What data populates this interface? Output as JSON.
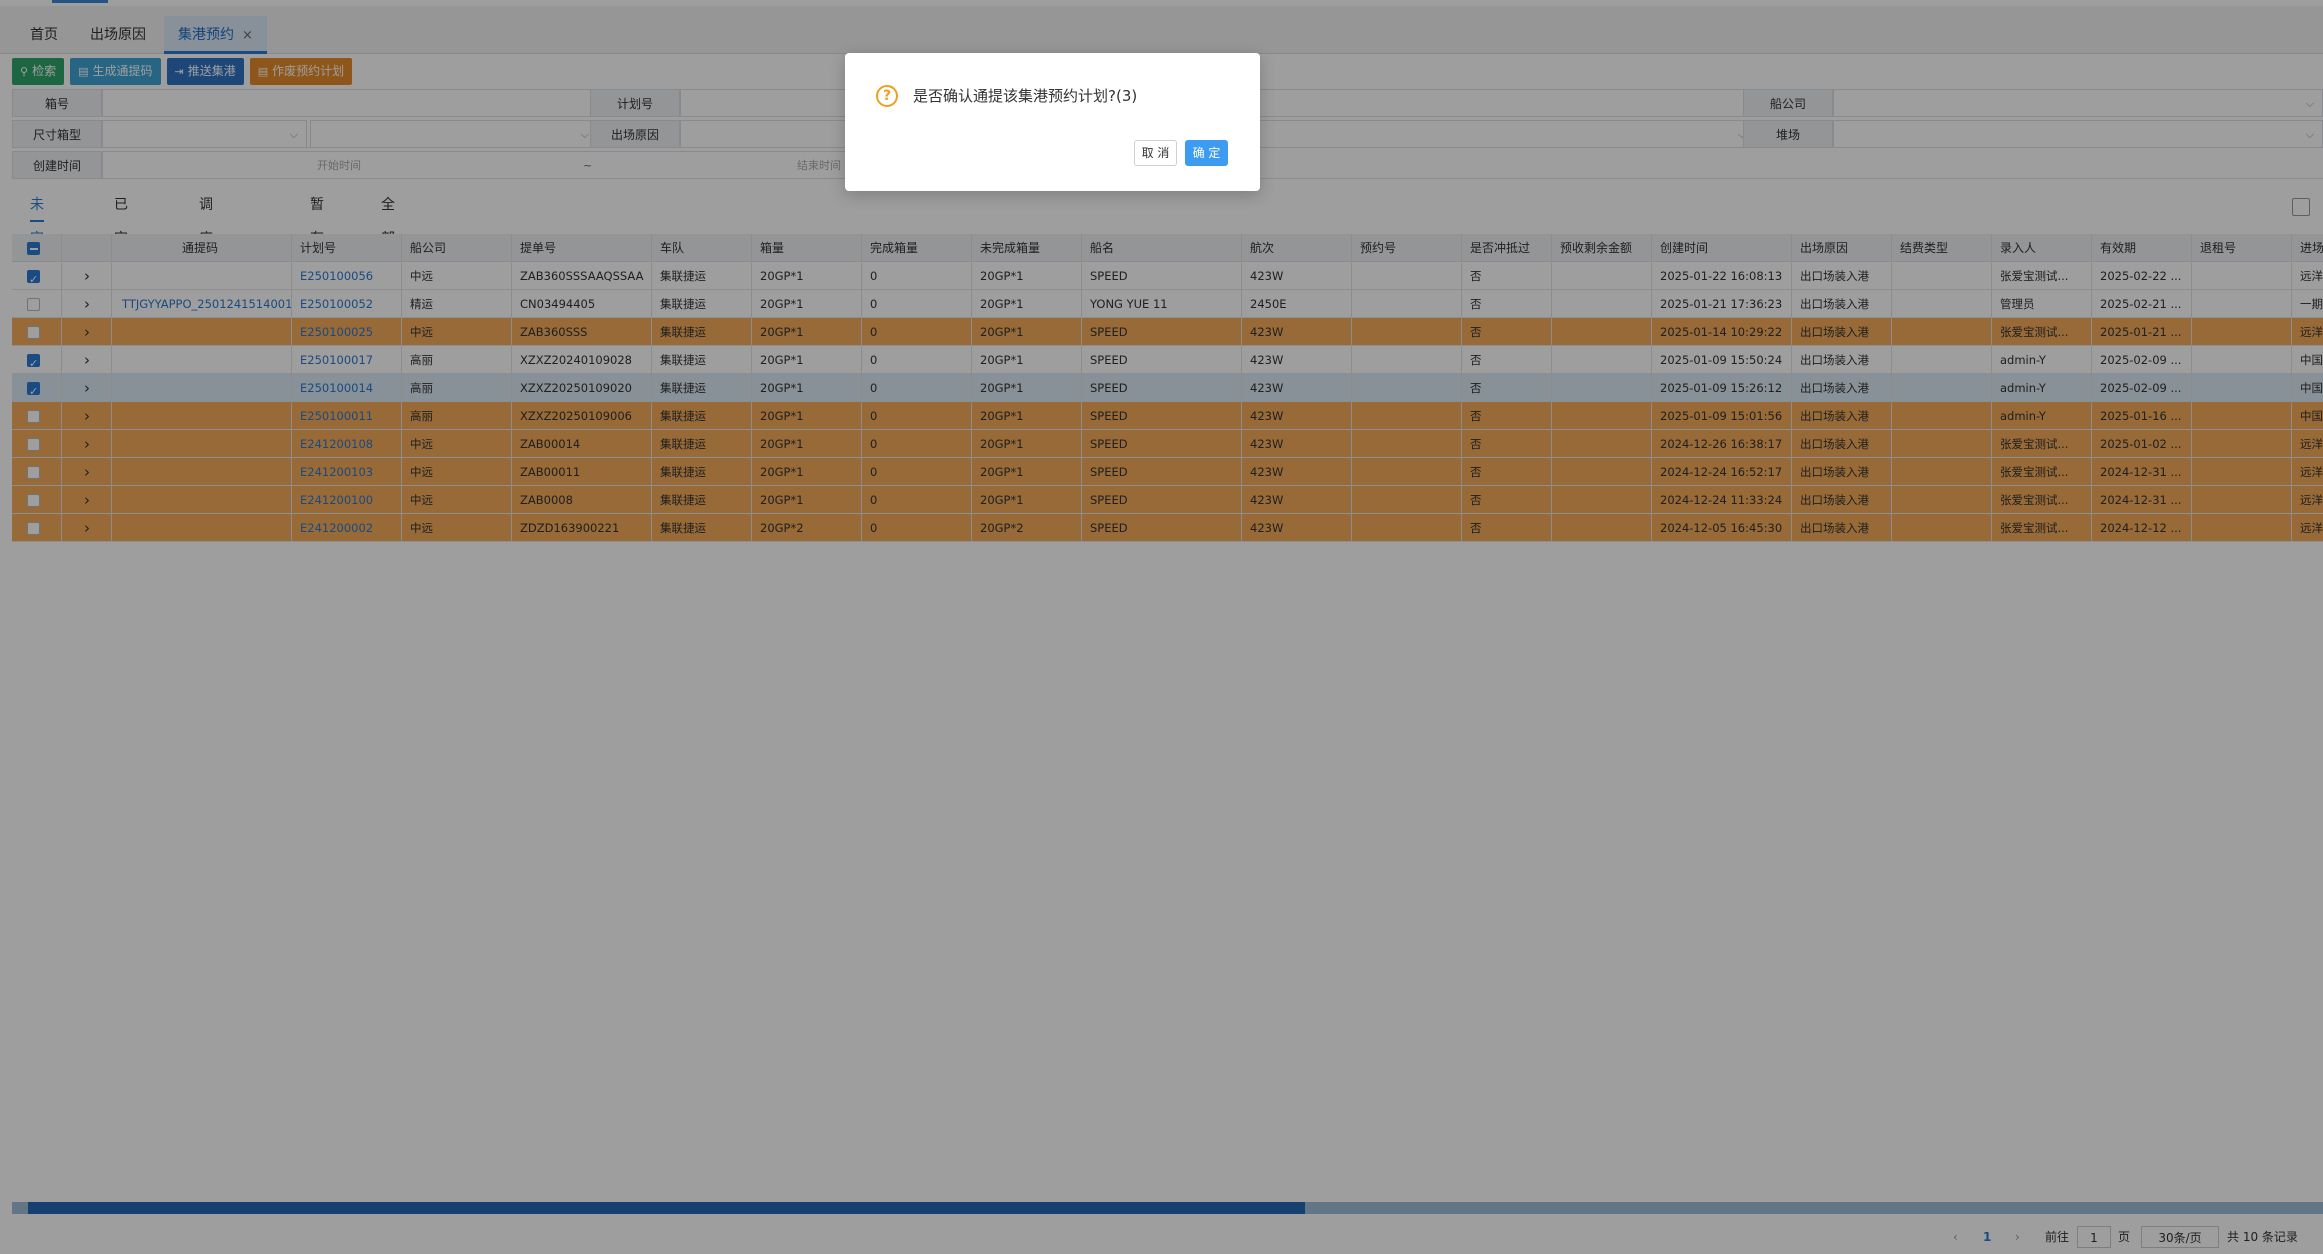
{
  "tabs": [
    {
      "label": "首页"
    },
    {
      "label": "出场原因"
    },
    {
      "label": "集港预约",
      "close": "×"
    }
  ],
  "toolbar": [
    {
      "label": "检索",
      "icon": "⚲",
      "color": "#2ea66a"
    },
    {
      "label": "生成通提码",
      "icon": "▤",
      "color": "#3fa3d6"
    },
    {
      "label": "推送集港",
      "icon": "⇥",
      "color": "#2f72c4"
    },
    {
      "label": "作废预约计划",
      "icon": "▤",
      "color": "#e58b2a"
    }
  ],
  "filters": {
    "box_no": "箱号",
    "plan_no": "计划号",
    "shipping_co": "船公司",
    "size_type": "尺寸箱型",
    "exit_reason": "出场原因",
    "yard": "堆场",
    "create_time": "创建时间",
    "start_ph": "开始时间",
    "dash": "~",
    "end_ph": "结束时间"
  },
  "subtabs": [
    {
      "label": "未完成"
    },
    {
      "label": "已完成"
    },
    {
      "label": "调度受理中"
    },
    {
      "label": "暂存"
    },
    {
      "label": "全部"
    }
  ],
  "columns": [
    "通提码",
    "计划号",
    "船公司",
    "提单号",
    "车队",
    "箱量",
    "完成箱量",
    "未完成箱量",
    "船名",
    "航次",
    "预约号",
    "是否冲抵过",
    "预收剩余金额",
    "创建时间",
    "出场原因",
    "结费类型",
    "录入人",
    "有效期",
    "退租号",
    "进场"
  ],
  "rows": [
    {
      "state": "normal",
      "checked": true,
      "code": "",
      "plan": "E250100056",
      "co": "中远",
      "bl": "ZAB360SSSAAQSSAA",
      "fleet": "集联捷运",
      "qty": "20GP*1",
      "done": "0",
      "undone": "20GP*1",
      "ship": "SPEED",
      "voy": "423W",
      "appt": "",
      "offset": "否",
      "prepaid": "",
      "created": "2025-01-22 16:08:13",
      "reason": "出口场装入港",
      "fee": "",
      "by": "张爱宝测试...",
      "valid": "2025-02-22 ...",
      "ret": "",
      "inport": "远洋"
    },
    {
      "state": "normal",
      "checked": false,
      "code": "TTJGYYAPPO_2501241514001",
      "plan": "E250100052",
      "co": "精运",
      "bl": "CN03494405",
      "fleet": "集联捷运",
      "qty": "20GP*1",
      "done": "0",
      "undone": "20GP*1",
      "ship": "YONG YUE 11",
      "voy": "2450E",
      "appt": "",
      "offset": "否",
      "prepaid": "",
      "created": "2025-01-21 17:36:23",
      "reason": "出口场装入港",
      "fee": "",
      "by": "管理员",
      "valid": "2025-02-21 ...",
      "ret": "",
      "inport": "一期"
    },
    {
      "state": "warn",
      "checked": false,
      "code": "",
      "plan": "E250100025",
      "co": "中远",
      "bl": "ZAB360SSS",
      "fleet": "集联捷运",
      "qty": "20GP*1",
      "done": "0",
      "undone": "20GP*1",
      "ship": "SPEED",
      "voy": "423W",
      "appt": "",
      "offset": "否",
      "prepaid": "",
      "created": "2025-01-14 10:29:22",
      "reason": "出口场装入港",
      "fee": "",
      "by": "张爱宝测试...",
      "valid": "2025-01-21 ...",
      "ret": "",
      "inport": "远洋"
    },
    {
      "state": "normal",
      "checked": true,
      "code": "",
      "plan": "E250100017",
      "co": "高丽",
      "bl": "XZXZ20240109028",
      "fleet": "集联捷运",
      "qty": "20GP*1",
      "done": "0",
      "undone": "20GP*1",
      "ship": "SPEED",
      "voy": "423W",
      "appt": "",
      "offset": "否",
      "prepaid": "",
      "created": "2025-01-09 15:50:24",
      "reason": "出口场装入港",
      "fee": "",
      "by": "admin-Y",
      "valid": "2025-02-09 ...",
      "ret": "",
      "inport": "中国"
    },
    {
      "state": "sel",
      "checked": true,
      "code": "",
      "plan": "E250100014",
      "co": "高丽",
      "bl": "XZXZ20250109020",
      "fleet": "集联捷运",
      "qty": "20GP*1",
      "done": "0",
      "undone": "20GP*1",
      "ship": "SPEED",
      "voy": "423W",
      "appt": "",
      "offset": "否",
      "prepaid": "",
      "created": "2025-01-09 15:26:12",
      "reason": "出口场装入港",
      "fee": "",
      "by": "admin-Y",
      "valid": "2025-02-09 ...",
      "ret": "",
      "inport": "中国"
    },
    {
      "state": "warn",
      "checked": false,
      "code": "",
      "plan": "E250100011",
      "co": "高丽",
      "bl": "XZXZ20250109006",
      "fleet": "集联捷运",
      "qty": "20GP*1",
      "done": "0",
      "undone": "20GP*1",
      "ship": "SPEED",
      "voy": "423W",
      "appt": "",
      "offset": "否",
      "prepaid": "",
      "created": "2025-01-09 15:01:56",
      "reason": "出口场装入港",
      "fee": "",
      "by": "admin-Y",
      "valid": "2025-01-16 ...",
      "ret": "",
      "inport": "中国"
    },
    {
      "state": "warn",
      "checked": false,
      "code": "",
      "plan": "E241200108",
      "co": "中远",
      "bl": "ZAB00014",
      "fleet": "集联捷运",
      "qty": "20GP*1",
      "done": "0",
      "undone": "20GP*1",
      "ship": "SPEED",
      "voy": "423W",
      "appt": "",
      "offset": "否",
      "prepaid": "",
      "created": "2024-12-26 16:38:17",
      "reason": "出口场装入港",
      "fee": "",
      "by": "张爱宝测试...",
      "valid": "2025-01-02 ...",
      "ret": "",
      "inport": "远洋"
    },
    {
      "state": "warn",
      "checked": false,
      "code": "",
      "plan": "E241200103",
      "co": "中远",
      "bl": "ZAB00011",
      "fleet": "集联捷运",
      "qty": "20GP*1",
      "done": "0",
      "undone": "20GP*1",
      "ship": "SPEED",
      "voy": "423W",
      "appt": "",
      "offset": "否",
      "prepaid": "",
      "created": "2024-12-24 16:52:17",
      "reason": "出口场装入港",
      "fee": "",
      "by": "张爱宝测试...",
      "valid": "2024-12-31 ...",
      "ret": "",
      "inport": "远洋"
    },
    {
      "state": "warn",
      "checked": false,
      "code": "",
      "plan": "E241200100",
      "co": "中远",
      "bl": "ZAB0008",
      "fleet": "集联捷运",
      "qty": "20GP*1",
      "done": "0",
      "undone": "20GP*1",
      "ship": "SPEED",
      "voy": "423W",
      "appt": "",
      "offset": "否",
      "prepaid": "",
      "created": "2024-12-24 11:33:24",
      "reason": "出口场装入港",
      "fee": "",
      "by": "张爱宝测试...",
      "valid": "2024-12-31 ...",
      "ret": "",
      "inport": "远洋"
    },
    {
      "state": "warn",
      "checked": false,
      "code": "",
      "plan": "E241200002",
      "co": "中远",
      "bl": "ZDZD163900221",
      "fleet": "集联捷运",
      "qty": "20GP*2",
      "done": "0",
      "undone": "20GP*2",
      "ship": "SPEED",
      "voy": "423W",
      "appt": "",
      "offset": "否",
      "prepaid": "",
      "created": "2024-12-05 16:45:30",
      "reason": "出口场装入港",
      "fee": "",
      "by": "张爱宝测试...",
      "valid": "2024-12-12 ...",
      "ret": "",
      "inport": "远洋"
    }
  ],
  "pager": {
    "prev": "‹",
    "page": "1",
    "next": "›",
    "goto": "前往",
    "goto_val": "1",
    "page_unit": "页",
    "page_size": "30条/页",
    "total": "共 10 条记录"
  },
  "dialog": {
    "icon": "?",
    "message": "是否确认通提该集港预约计划?(3)",
    "cancel": "取 消",
    "ok": "确 定"
  }
}
